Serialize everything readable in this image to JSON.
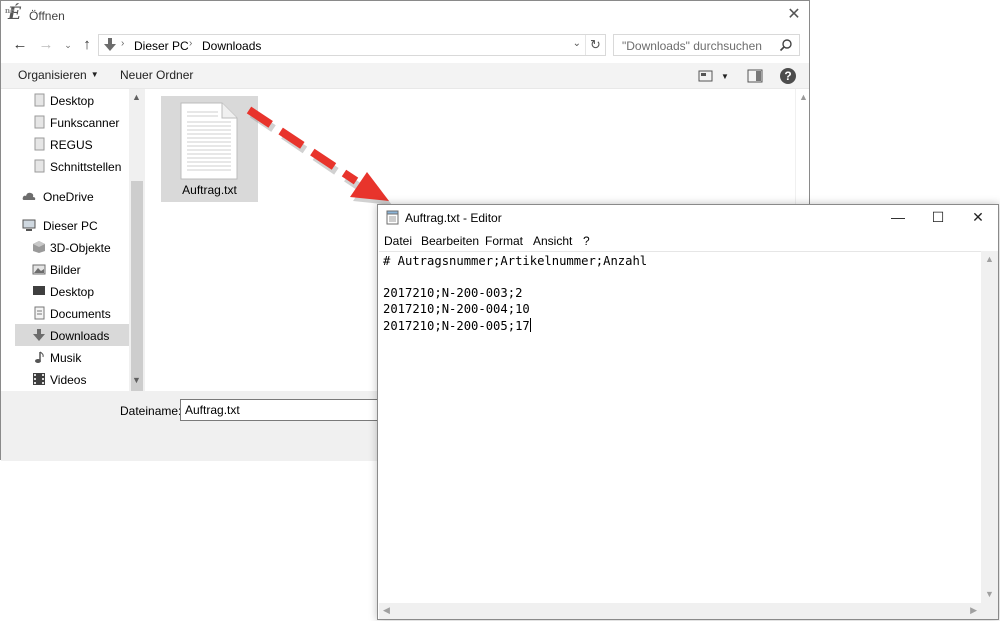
{
  "open_dialog": {
    "title": "Öffnen",
    "app_icon_glyph": "É",
    "app_icon_prefix": "ne",
    "close_glyph": "✕",
    "nav": {
      "back": "←",
      "forward": "→",
      "recent": "⌄",
      "up": "↑"
    },
    "breadcrumb": [
      "Dieser PC",
      "Downloads"
    ],
    "breadcrumb_separator": "›",
    "address_dropdown": "⌄",
    "refresh_glyph": "↻",
    "search_placeholder": "\"Downloads\" durchsuchen",
    "toolbar": {
      "organize_label": "Organisieren",
      "organize_arrow": "▼",
      "new_folder_label": "Neuer Ordner",
      "view_arrow": "▼",
      "help_glyph": "?"
    },
    "sidebar": {
      "items": [
        {
          "label": "Desktop",
          "icon": "folder-icon",
          "level": 1
        },
        {
          "label": "Funkscanner",
          "icon": "folder-icon",
          "level": 1
        },
        {
          "label": "REGUS",
          "icon": "folder-icon",
          "level": 1
        },
        {
          "label": "Schnittstellen",
          "icon": "folder-icon",
          "level": 1
        },
        {
          "label": "OneDrive",
          "icon": "cloud-icon",
          "level": 0
        },
        {
          "label": "Dieser PC",
          "icon": "computer-icon",
          "level": 0
        },
        {
          "label": "3D-Objekte",
          "icon": "cube-icon",
          "level": 1
        },
        {
          "label": "Bilder",
          "icon": "pictures-icon",
          "level": 1
        },
        {
          "label": "Desktop",
          "icon": "desktop-icon",
          "level": 1
        },
        {
          "label": "Documents",
          "icon": "documents-icon",
          "level": 1
        },
        {
          "label": "Downloads",
          "icon": "download-icon",
          "level": 1,
          "selected": true
        },
        {
          "label": "Musik",
          "icon": "music-icon",
          "level": 1
        },
        {
          "label": "Videos",
          "icon": "video-icon",
          "level": 1
        }
      ],
      "scroll_up": "▲",
      "scroll_down": "▼"
    },
    "files": [
      {
        "name": "Auftrag.txt",
        "icon": "text-file-icon",
        "selected": true
      }
    ],
    "main_scroll_up": "▲",
    "filename_label": "Dateiname:",
    "filename_value": "Auftrag.txt"
  },
  "editor": {
    "title": "Auftrag.txt - Editor",
    "controls": {
      "minimize": "—",
      "maximize": "☐",
      "close": "✕"
    },
    "menu": [
      "Datei",
      "Bearbeiten",
      "Format",
      "Ansicht",
      "?"
    ],
    "lines": [
      "# Autragsnummer;Artikelnummer;Anzahl",
      "",
      "2017210;N-200-003;2",
      "2017210;N-200-004;10",
      "2017210;N-200-005;17"
    ],
    "scroll": {
      "up": "▲",
      "down": "▼",
      "left": "◀",
      "right": "▶"
    }
  },
  "colors": {
    "selection_bg": "#d9d9d9",
    "arrow_red": "#e8342c",
    "arrow_shadow": "#9a9a9a",
    "dialog_bottom_bg": "#f0f0f0"
  }
}
